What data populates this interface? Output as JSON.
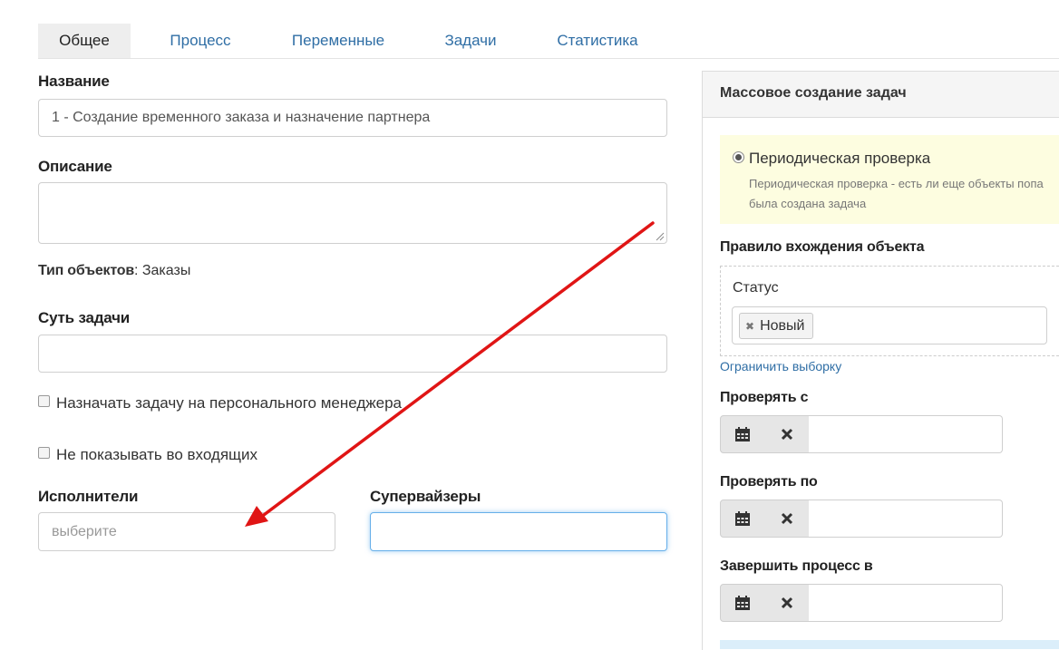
{
  "tabs": [
    "Общее",
    "Процесс",
    "Переменные",
    "Задачи",
    "Статистика"
  ],
  "form": {
    "name_label": "Название",
    "name_value": "1 - Создание временного заказа и назначение партнера",
    "description_label": "Описание",
    "description_value": "",
    "object_type_label": "Тип объектов",
    "object_type_value": ": Заказы",
    "task_essence_label": "Суть задачи",
    "task_essence_value": "",
    "assign_personal_manager_label": "Назначать задачу на персонального менеджера",
    "hide_in_inbox_label": "Не показывать во входящих",
    "executors_label": "Исполнители",
    "executors_placeholder": "выберите",
    "supervisors_label": "Супервайзеры",
    "supervisors_value": ""
  },
  "panel": {
    "title": "Массовое создание задач",
    "mode_label": "Периодическая проверка",
    "mode_description_line1": "Периодическая проверка - есть ли еще объекты попа",
    "mode_description_line2": "была создана задача",
    "rule_label": "Правило вхождения объекта",
    "status_label": "Статус",
    "status_tag": "Новый",
    "restrict_link": "Ограничить выборку",
    "check_from_label": "Проверять с",
    "check_to_label": "Проверять по",
    "finish_label": "Завершить процесс в"
  },
  "icons": {
    "calendar": "calendar-icon",
    "clear": "close-icon",
    "tag_remove": "close-icon"
  },
  "colors": {
    "link": "#2f6ea5",
    "notice_bg": "#fdfde0",
    "annotation_arrow": "#e01515",
    "focus_border": "#66afe9"
  }
}
